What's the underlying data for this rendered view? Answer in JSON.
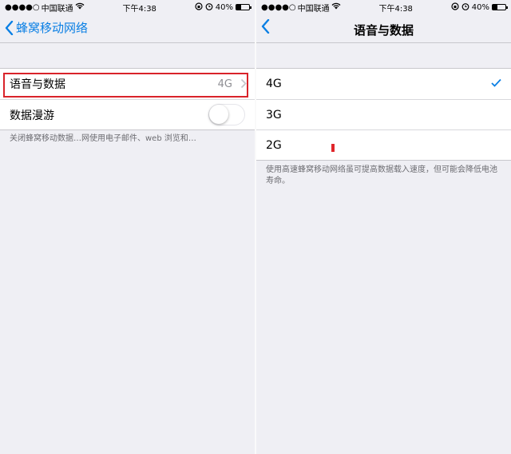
{
  "status_bar": {
    "carrier": "中国联通",
    "time": "下午4:38",
    "battery": "40%",
    "battery_level": 0.4
  },
  "left_screen": {
    "nav": {
      "back_label": "蜂窝移动网络"
    },
    "rows": [
      {
        "label": "语音与数据",
        "value": "4G"
      },
      {
        "label": "数据漫游",
        "toggle_on": false
      }
    ],
    "footnote": "关闭蜂窝移动数据…网使用电子邮件、web 浏览和…"
  },
  "right_screen": {
    "nav": {
      "title": "语音与数据"
    },
    "options": [
      {
        "label": "4G",
        "selected": true
      },
      {
        "label": "3G",
        "selected": false
      },
      {
        "label": "2G",
        "selected": false
      }
    ],
    "footnote": "使用高速蜂窝移动网络虽可提高数据载入速度，但可能会降低电池寿命。"
  },
  "colors": {
    "accent": "#0a7fe4",
    "highlight": "#d9232a",
    "background": "#efeff4"
  },
  "icons": [
    "signal-dots-icon",
    "wifi-icon",
    "orientation-lock-icon",
    "alarm-icon",
    "battery-icon",
    "back-chevron-icon",
    "chevron-right-icon",
    "checkmark-icon"
  ]
}
